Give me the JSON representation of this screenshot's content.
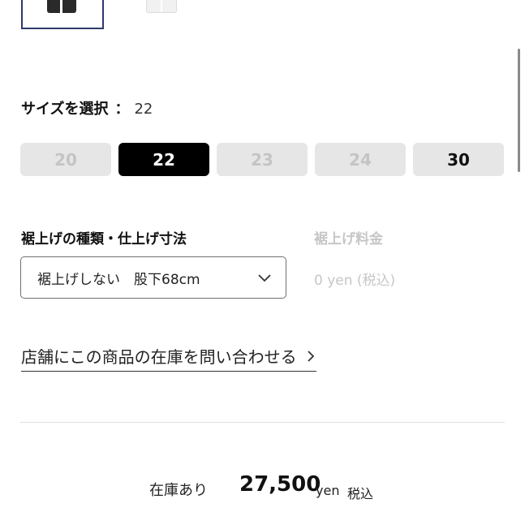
{
  "thumbnails": [
    {
      "color_name": "black",
      "selected": true
    },
    {
      "color_name": "white",
      "selected": false
    }
  ],
  "size_selector": {
    "label": "サイズを選択",
    "colon": "：",
    "selected_value": "22",
    "options": [
      {
        "label": "20",
        "state": "unavailable"
      },
      {
        "label": "22",
        "state": "selected"
      },
      {
        "label": "23",
        "state": "unavailable"
      },
      {
        "label": "24",
        "state": "unavailable"
      },
      {
        "label": "30",
        "state": "available"
      }
    ]
  },
  "hemming": {
    "heading": "裾上げの種類・仕上げ寸法",
    "selected_option": "裾上げしない　股下68cm",
    "fee_heading": "裾上げ料金",
    "fee_value": "0 yen (税込)"
  },
  "store_inquiry": {
    "label": "店舗にこの商品の在庫を問い合わせる"
  },
  "price_row": {
    "stock_status": "在庫あり",
    "price": "27,500",
    "currency": "yen",
    "tax_note": "税込"
  },
  "colors": {
    "thumbnail_border": "#2d3a6e",
    "selected_bg": "#000000",
    "button_bg": "#e6e6e6",
    "disabled_text": "#c4c4c4"
  },
  "icons": {
    "select_chevron": "chevron-down-icon",
    "link_arrow": "chevron-right-icon"
  }
}
